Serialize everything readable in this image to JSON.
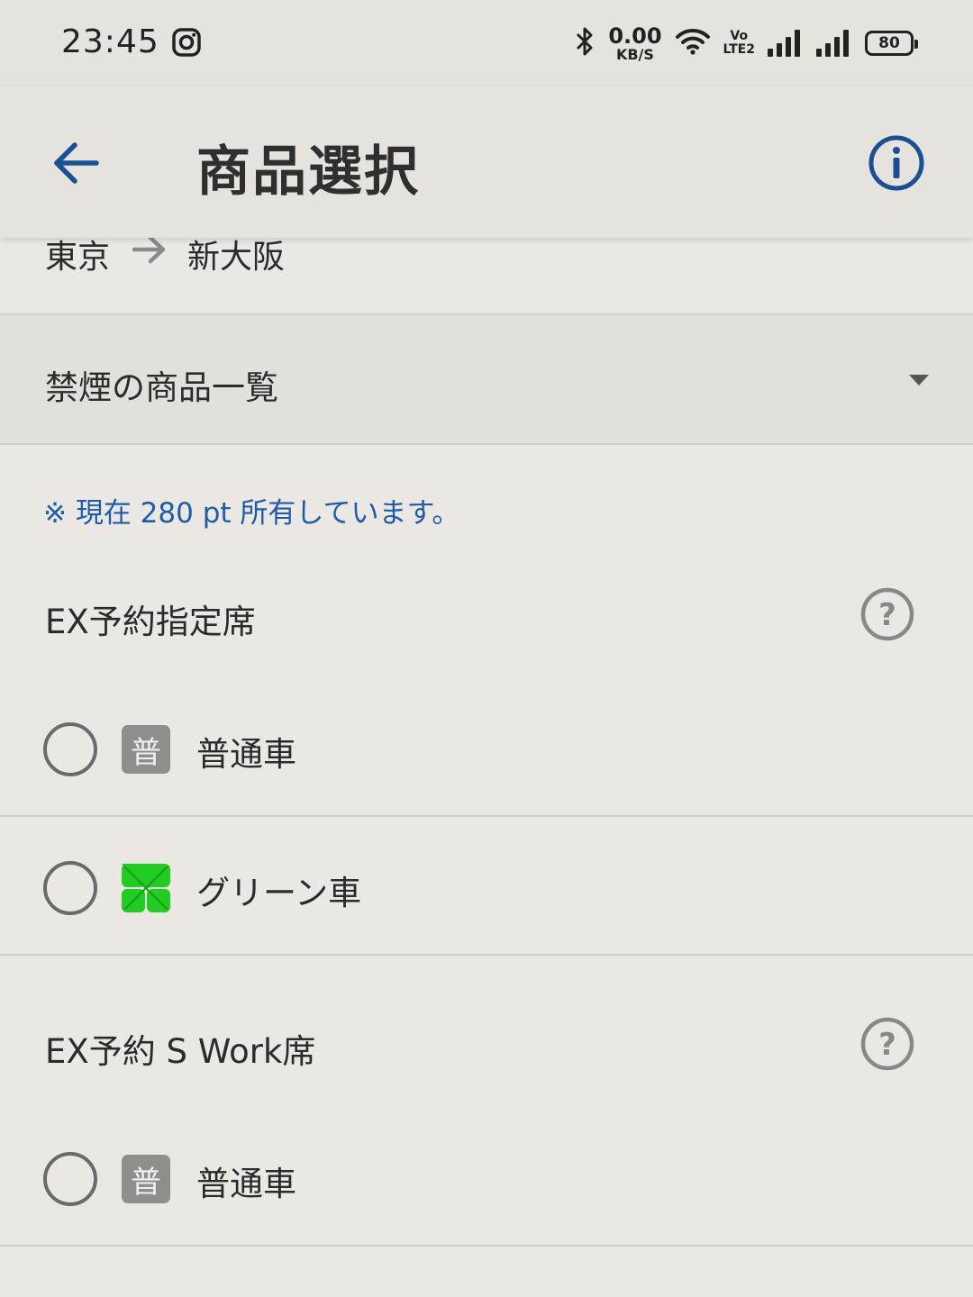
{
  "status_bar": {
    "time": "23:45",
    "net_speed_value": "0.00",
    "net_speed_unit": "KB/S",
    "volte_top": "Vo",
    "volte_bottom": "LTE2",
    "battery": "80",
    "icons": [
      "instagram-icon",
      "bluetooth-icon",
      "wifi-icon",
      "signal-icon",
      "signal-icon",
      "battery-icon"
    ]
  },
  "app_bar": {
    "title": "商品選択",
    "back_icon": "arrow-left-icon",
    "info_icon": "info-circle-icon",
    "accent_color": "#1a4f94"
  },
  "route": {
    "from": "東京",
    "to": "新大阪",
    "arrow_icon": "arrow-right-icon"
  },
  "dropdown": {
    "label": "禁煙の商品一覧",
    "caret_icon": "caret-down-icon"
  },
  "points_note": "※ 現在 280 pt 所有しています。",
  "sections": [
    {
      "title": "EX予約指定席",
      "help_icon": "question-circle-icon",
      "options": [
        {
          "badge": "普",
          "label": "普通車",
          "selected": false
        },
        {
          "badge": "",
          "badge_icon": "green-car-icon",
          "label": "グリーン車",
          "selected": false
        }
      ]
    },
    {
      "title": "EX予約 S Work席",
      "help_icon": "question-circle-icon",
      "options": [
        {
          "badge": "普",
          "label": "普通車",
          "selected": false
        }
      ]
    }
  ],
  "colors": {
    "background": "#ebe8e4",
    "note_blue": "#1f5ca8",
    "green_badge": "#22cc22",
    "badge_gray": "#8f8e8c"
  }
}
